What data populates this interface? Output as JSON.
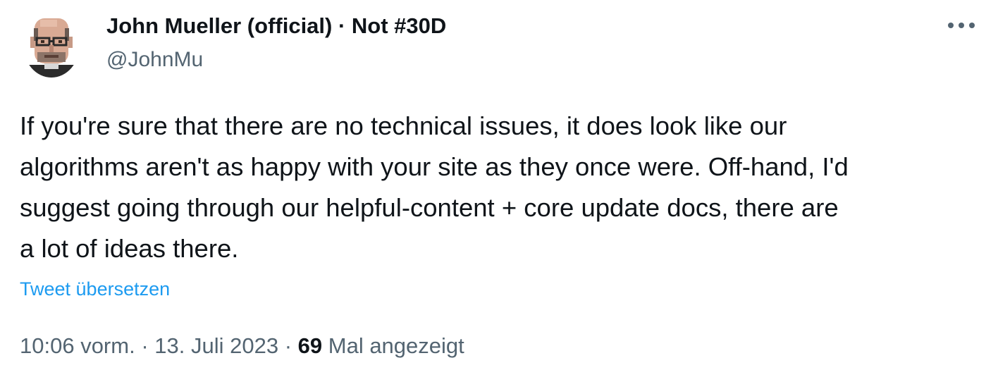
{
  "tweet": {
    "author": {
      "display_name": "John Mueller (official) · Not #30D",
      "handle": "@JohnMu",
      "avatar_icon": "pixel-art-portrait-avatar"
    },
    "more_icon": "more-horizontal-icon",
    "text": "If you're sure that there are no technical issues, it does look like our\nalgorithms aren't as happy with your site as they once were. Off-hand, I'd\nsuggest going through our helpful-content + core update docs, there are\na lot of ideas there.",
    "translate_label": "Tweet übersetzen",
    "time": "10:06 vorm.",
    "separator": " · ",
    "date": "13. Juli 2023",
    "views_count": "69",
    "views_label": "Mal angezeigt"
  },
  "colors": {
    "text_primary": "#0f1419",
    "text_secondary": "#536471",
    "link": "#1d9bf0"
  }
}
